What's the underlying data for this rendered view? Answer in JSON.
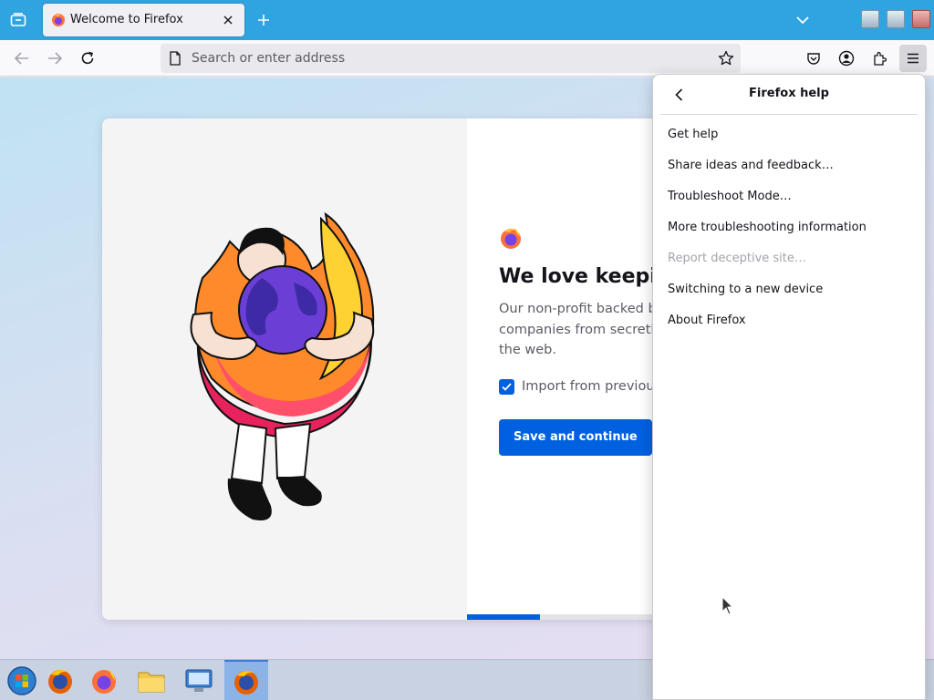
{
  "tab": {
    "title": "Welcome to Firefox"
  },
  "urlbar": {
    "placeholder": "Search or enter address"
  },
  "page": {
    "headline": "We love keepir",
    "body_lines": [
      "Our non-profit backed b",
      "companies from secretly",
      "the web."
    ],
    "checkbox_label": "Import from previous",
    "checkbox_checked": true,
    "primary_button": "Save and continue",
    "progress_fraction": 0.25
  },
  "help_panel": {
    "title": "Firefox help",
    "items": [
      {
        "label": "Get help",
        "enabled": true
      },
      {
        "label": "Share ideas and feedback…",
        "enabled": true
      },
      {
        "label": "Troubleshoot Mode…",
        "enabled": true
      },
      {
        "label": "More troubleshooting information",
        "enabled": true
      },
      {
        "label": "Report deceptive site…",
        "enabled": false
      },
      {
        "label": "Switching to a new device",
        "enabled": true
      },
      {
        "label": "About Firefox",
        "enabled": true
      }
    ]
  },
  "taskbar": {
    "items": [
      "start-menu-icon",
      "firefox-icon",
      "firefox-browser-icon",
      "file-manager-icon",
      "system-settings-icon",
      "firefox-active-icon"
    ]
  },
  "colors": {
    "accent": "#0061e0",
    "tabstrip": "#2fa4e0"
  }
}
